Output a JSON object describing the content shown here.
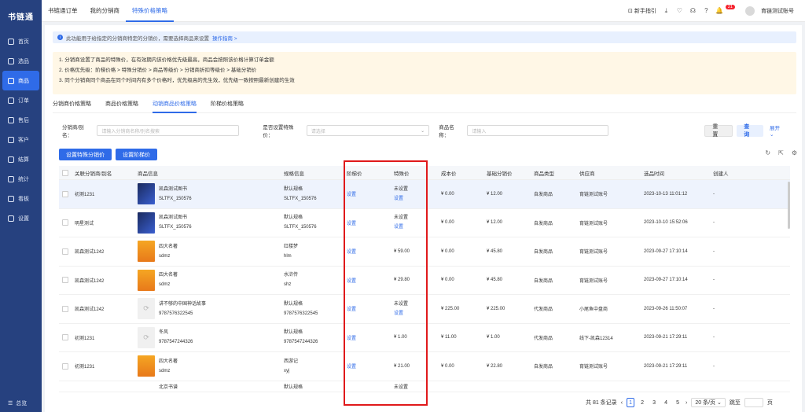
{
  "sidebar": {
    "logo": "书链通",
    "items": [
      {
        "label": "首页",
        "icon": "home-icon"
      },
      {
        "label": "选品",
        "icon": "box-icon"
      },
      {
        "label": "商品",
        "icon": "goods-icon",
        "active": true
      },
      {
        "label": "订单",
        "icon": "order-icon"
      },
      {
        "label": "售后",
        "icon": "service-icon"
      },
      {
        "label": "客户",
        "icon": "user-icon"
      },
      {
        "label": "结算",
        "icon": "settle-icon"
      },
      {
        "label": "统计",
        "icon": "stats-icon"
      },
      {
        "label": "看板",
        "icon": "board-icon"
      },
      {
        "label": "设置",
        "icon": "settings-icon"
      }
    ],
    "collapse_label": "总览"
  },
  "topbar": {
    "tabs": [
      "书链通订单",
      "我的分销商",
      "特殊价格策略"
    ],
    "active_tab": 2,
    "guide": "新手指引",
    "badge": "21",
    "account": "育链测试账号"
  },
  "info": {
    "text": "此功能用于给指定的分销商特定的分销价，需要选择商品来设置",
    "link": "操作指南 >"
  },
  "notice": [
    "1. 分销商设置了商品的特殊价，在有效期内该价格优先级最高，商品会按照该价格计算订单金额",
    "2. 价格优先级：阶梯价格 > 特殊分销价 > 商品等级价 > 分销商折扣等级价 > 基础分销价",
    "3. 同个分销商同个商品在同个时间内有多个价格时，优先级高的先生效，优先级一致按照最新创建的生效"
  ],
  "subtabs": [
    "分销商价格策略",
    "商品价格策略",
    "动销商品价格策略",
    "阶梯价格策略"
  ],
  "filters": {
    "distributor_label": "分销商/别名：",
    "distributor_placeholder": "请输入分销商名称/别名搜索",
    "special_label": "是否设置特殊价：",
    "special_placeholder": "请选择",
    "product_label": "商品名称：",
    "product_placeholder": "请输入",
    "reset": "重 置",
    "query": "查 询",
    "expand": "展开"
  },
  "actions": {
    "set_special": "设置特殊分销价",
    "set_tier": "设置阶梯价"
  },
  "table": {
    "headers": [
      "关联分销商/别名",
      "商品信息",
      "规格信息",
      "阶梯价",
      "特殊价",
      "成本价",
      "基础分销价",
      "商品类型",
      "供应商",
      "选品时间",
      "创建人"
    ],
    "rows": [
      {
        "dist": "初测1231",
        "name": "凯森测试图书",
        "code": "SLTFX_150576",
        "spec": "默认规格",
        "spec_code": "SLTFX_150576",
        "tier": "设置",
        "special": "未设置",
        "special_link": "设置",
        "cost": "¥ 0.00",
        "base": "¥ 12.00",
        "type": "自发商品",
        "supplier": "育链测试账号",
        "time": "2023-10-13 11:01:12",
        "creator": "-",
        "thumb": "dark"
      },
      {
        "dist": "明星测试",
        "name": "凯森测试图书",
        "code": "SLTFX_150576",
        "spec": "默认规格",
        "spec_code": "SLTFX_150576",
        "tier": "设置",
        "special": "未设置",
        "special_link": "设置",
        "cost": "¥ 0.00",
        "base": "¥ 12.00",
        "type": "自发商品",
        "supplier": "育链测试账号",
        "time": "2023-10-10 15:52:06",
        "creator": "-",
        "thumb": "dark"
      },
      {
        "dist": "凯森测试1242",
        "name": "四大名著",
        "code": "sdmz",
        "spec": "红楼梦",
        "spec_code": "hlm",
        "tier": "设置",
        "special": "¥ 59.00",
        "special_link": "",
        "cost": "¥ 0.00",
        "base": "¥ 45.80",
        "type": "自发商品",
        "supplier": "育链测试账号",
        "time": "2023-09-27 17:10:14",
        "creator": "-",
        "thumb": "orange"
      },
      {
        "dist": "凯森测试1242",
        "name": "四大名著",
        "code": "sdmz",
        "spec": "水浒传",
        "spec_code": "shz",
        "tier": "设置",
        "special": "¥ 29.80",
        "special_link": "",
        "cost": "¥ 0.00",
        "base": "¥ 45.80",
        "type": "自发商品",
        "supplier": "育链测试账号",
        "time": "2023-09-27 17:10:14",
        "creator": "-",
        "thumb": "orange"
      },
      {
        "dist": "凯森测试1242",
        "name": "讲不够的中国神话故事",
        "code": "9787576322545",
        "spec": "默认规格",
        "spec_code": "9787576322545",
        "tier": "设置",
        "special": "未设置",
        "special_link": "设置",
        "cost": "¥ 225.00",
        "base": "¥ 225.00",
        "type": "代发商品",
        "supplier": "小尾鱼中盘商",
        "time": "2023-09-26 11:50:07",
        "creator": "-",
        "thumb": "gray"
      },
      {
        "dist": "初测1231",
        "name": "冬风",
        "code": "9787547244326",
        "spec": "默认规格",
        "spec_code": "9787547244326",
        "tier": "设置",
        "special": "¥ 1.00",
        "special_link": "",
        "cost": "¥ 11.00",
        "base": "¥ 1.00",
        "type": "代发商品",
        "supplier": "线下-凯森12314",
        "time": "2023-09-21 17:29:11",
        "creator": "-",
        "thumb": "gray"
      },
      {
        "dist": "初测1231",
        "name": "四大名著",
        "code": "sdmz",
        "spec": "西游记",
        "spec_code": "xyj",
        "tier": "设置",
        "special": "¥ 21.00",
        "special_link": "",
        "cost": "¥ 0.00",
        "base": "¥ 22.80",
        "type": "自发商品",
        "supplier": "育链测试账号",
        "time": "2023-09-21 17:29:11",
        "creator": "-",
        "thumb": "orange"
      }
    ],
    "partial_row": {
      "name": "北京书谱",
      "spec": "默认规格",
      "special": "未设置"
    }
  },
  "pager": {
    "total": "共 81 条记录",
    "pages": [
      "1",
      "2",
      "3",
      "4",
      "5"
    ],
    "page_size": "20 条/页",
    "jump": "跳至",
    "page_unit": "页"
  }
}
